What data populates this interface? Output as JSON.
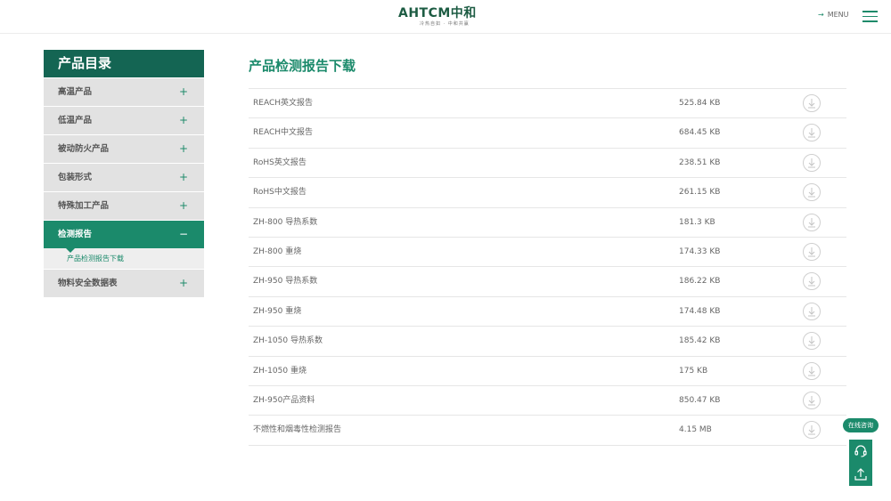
{
  "header": {
    "logo_text": "AHTCM中和",
    "logo_tagline": "冷热自如 · 中和共赢",
    "menu_label": "MENU",
    "menu_arrow": "→"
  },
  "sidebar": {
    "title": "产品目录",
    "items": [
      {
        "label": "高温产品",
        "toggle": "+"
      },
      {
        "label": "低温产品",
        "toggle": "+"
      },
      {
        "label": "被动防火产品",
        "toggle": "+"
      },
      {
        "label": "包装形式",
        "toggle": "+"
      },
      {
        "label": "特殊加工产品",
        "toggle": "+"
      },
      {
        "label": "检测报告",
        "toggle": "−"
      },
      {
        "label": "物料安全数据表",
        "toggle": "+"
      }
    ],
    "sub_item": "产品检测报告下载"
  },
  "main": {
    "title": "产品检测报告下载",
    "files": [
      {
        "name": "REACH英文报告",
        "size": "525.84 KB"
      },
      {
        "name": "REACH中文报告",
        "size": "684.45 KB"
      },
      {
        "name": "RoHS英文报告",
        "size": "238.51 KB"
      },
      {
        "name": "RoHS中文报告",
        "size": "261.15 KB"
      },
      {
        "name": "ZH-800 导热系数",
        "size": "181.3 KB"
      },
      {
        "name": "ZH-800 重烧",
        "size": "174.33 KB"
      },
      {
        "name": "ZH-950 导热系数",
        "size": "186.22 KB"
      },
      {
        "name": "ZH-950 重烧",
        "size": "174.48 KB"
      },
      {
        "name": "ZH-1050 导热系数",
        "size": "185.42 KB"
      },
      {
        "name": "ZH-1050 重烧",
        "size": "175 KB"
      },
      {
        "name": "ZH-950产品资料",
        "size": "850.47 KB"
      },
      {
        "name": "不燃性和烟毒性检测报告",
        "size": "4.15 MB"
      }
    ]
  },
  "floating": {
    "consult_label": "在线咨询"
  },
  "colors": {
    "brand_green": "#1b8a6b",
    "dark_green": "#146553"
  }
}
